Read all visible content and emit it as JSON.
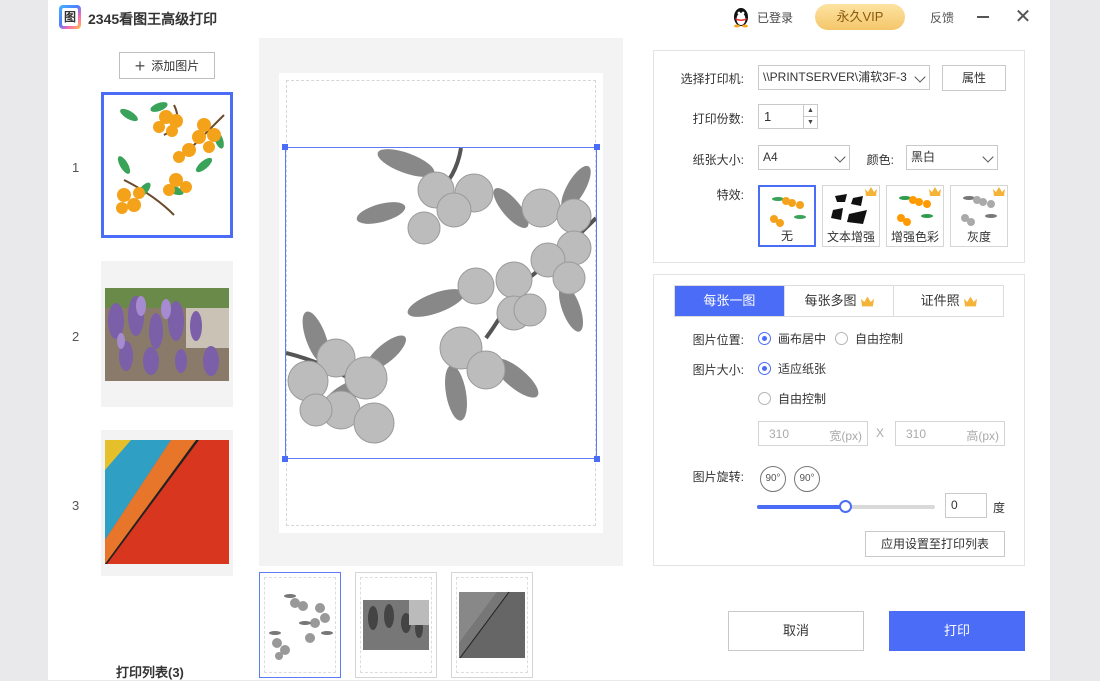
{
  "app": {
    "title": "2345看图王高级打印"
  },
  "titlebar": {
    "user_status": "已登录",
    "vip_label": "永久VIP",
    "feedback": "反馈"
  },
  "left": {
    "add_label": "添加图片",
    "items": [
      {
        "num": "1"
      },
      {
        "num": "2"
      },
      {
        "num": "3"
      }
    ],
    "footer": "打印列表(3)"
  },
  "settings": {
    "printer_label": "选择打印机:",
    "printer_value": "\\\\PRINTSERVER\\浦软3F-3",
    "properties_label": "属性",
    "copies_label": "打印份数:",
    "copies_value": "1",
    "paper_label": "纸张大小:",
    "paper_value": "A4",
    "color_label": "颜色:",
    "color_value": "黑白",
    "effects_label": "特效:",
    "effects": [
      {
        "label": "无"
      },
      {
        "label": "文本增强"
      },
      {
        "label": "增强色彩"
      },
      {
        "label": "灰度"
      }
    ]
  },
  "layout": {
    "tabs": [
      {
        "label": "每张一图"
      },
      {
        "label": "每张多图"
      },
      {
        "label": "证件照"
      }
    ],
    "position_label": "图片位置:",
    "position_opt1": "画布居中",
    "position_opt2": "自由控制",
    "size_label": "图片大小:",
    "size_opt1": "适应纸张",
    "size_opt2": "自由控制",
    "width_value": "310",
    "width_unit": "宽(px)",
    "x_sep": "X",
    "height_value": "310",
    "height_unit": "高(px)",
    "rotate_label": "图片旋转:",
    "rotate_ccw": "90°",
    "rotate_cw": "90°",
    "rotation_slider_fraction": 0.5,
    "rotation_value": "0",
    "rotation_unit": "度",
    "apply_label": "应用设置至打印列表"
  },
  "actions": {
    "cancel": "取消",
    "print": "打印"
  },
  "colors": {
    "accent": "#4a6cf7",
    "vip": "#f4c66a"
  }
}
